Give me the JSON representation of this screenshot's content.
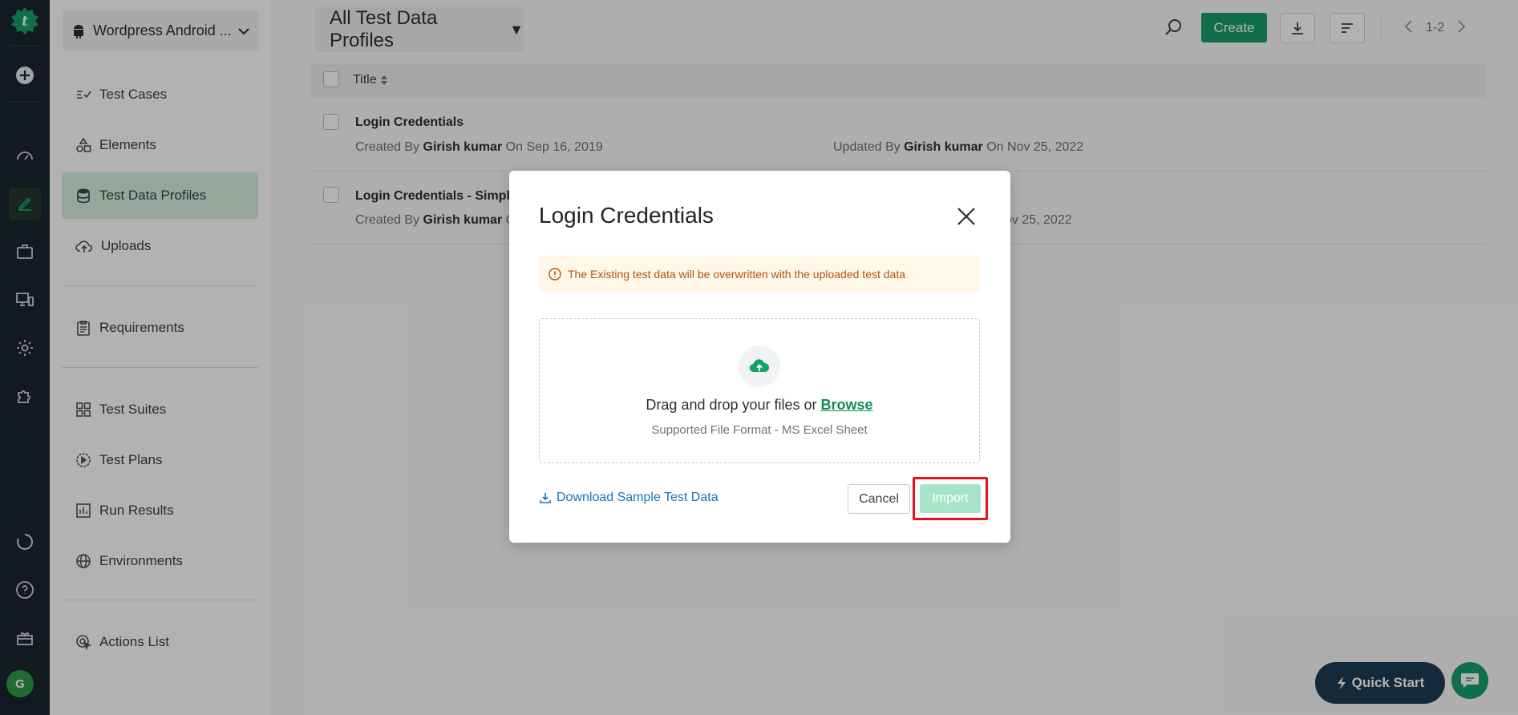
{
  "colors": {
    "accent": "#16a06a",
    "rail": "#1b2530",
    "warning_text": "#b45309",
    "link": "#1a73b8",
    "highlight": "#e0141f"
  },
  "rail": {
    "icons": [
      "testsigma-logo-icon",
      "add-circle-icon",
      "dashboard-icon",
      "edit-icon",
      "briefcase-icon",
      "devices-icon",
      "settings-icon",
      "puzzle-icon",
      "loader-icon",
      "help-icon",
      "gift-icon"
    ],
    "avatar_initial": "G"
  },
  "nav": {
    "project": "Wordpress Android ...",
    "items": [
      {
        "label": "Test Cases",
        "icon": "checklist-icon"
      },
      {
        "label": "Elements",
        "icon": "shapes-icon"
      },
      {
        "label": "Test Data Profiles",
        "icon": "database-icon",
        "active": true
      },
      {
        "label": "Uploads",
        "icon": "cloud-upload-icon"
      },
      {
        "label": "Requirements",
        "icon": "clipboard-icon"
      },
      {
        "label": "Test Suites",
        "icon": "grid-icon"
      },
      {
        "label": "Test Plans",
        "icon": "play-circle-icon"
      },
      {
        "label": "Run Results",
        "icon": "bar-chart-icon"
      },
      {
        "label": "Environments",
        "icon": "globe-icon"
      },
      {
        "label": "Actions List",
        "icon": "cursor-icon"
      }
    ]
  },
  "toolbar": {
    "filter_label": "All Test Data Profiles",
    "create_label": "Create",
    "pagination": "1-2"
  },
  "table": {
    "column_title": "Title",
    "rows": [
      {
        "title": "Login Credentials",
        "created_prefix": "Created By",
        "created_by": "Girish kumar",
        "created_on": "On Sep 16, 2019",
        "updated_prefix": "Updated By",
        "updated_by": "Girish kumar",
        "updated_on": "On Nov 25, 2022"
      },
      {
        "title": "Login Credentials - SimplyT",
        "created_prefix": "Created By",
        "created_by": "Girish kumar",
        "created_on": "O",
        "updated_on_visible": "ov 25, 2022"
      }
    ]
  },
  "quick_start": {
    "label": "Quick Start"
  },
  "modal": {
    "title": "Login Credentials",
    "warning": "The Existing test data will be overwritten with the uploaded test data",
    "drop_text": "Drag and drop your files or",
    "browse": "Browse",
    "supported": "Supported File Format - MS Excel Sheet",
    "download_link": "Download Sample Test Data",
    "cancel": "Cancel",
    "import": "Import"
  }
}
